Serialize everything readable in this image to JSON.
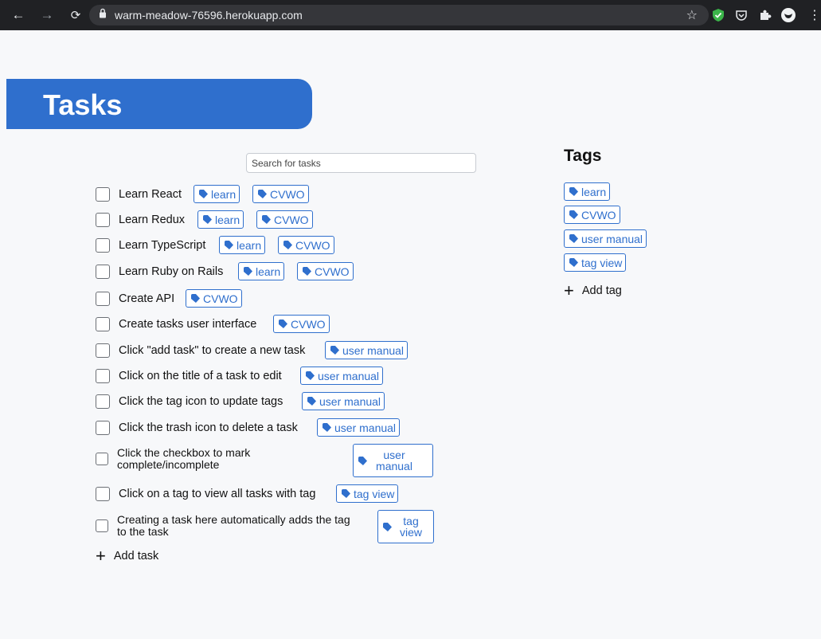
{
  "browser": {
    "url": "warm-meadow-76596.herokuapp.com",
    "back_icon": "arrow-left-icon",
    "forward_icon": "arrow-right-icon",
    "reload_icon": "reload-icon"
  },
  "header": {
    "title": "Tasks"
  },
  "search": {
    "placeholder": "Search for tasks",
    "value": ""
  },
  "tasks": [
    {
      "title": "Learn React",
      "tags": [
        "learn",
        "CVWO"
      ]
    },
    {
      "title": "Learn Redux",
      "tags": [
        "learn",
        "CVWO"
      ]
    },
    {
      "title": "Learn TypeScript",
      "tags": [
        "learn",
        "CVWO"
      ]
    },
    {
      "title": "Learn Ruby on Rails",
      "tags": [
        "learn",
        "CVWO"
      ]
    },
    {
      "title": "Create API",
      "tags": [
        "CVWO"
      ]
    },
    {
      "title": "Create tasks user interface",
      "tags": [
        "CVWO"
      ]
    },
    {
      "title": "Click \"add task\" to create a new task",
      "tags": [
        "user manual"
      ]
    },
    {
      "title": "Click on the title of a task to edit",
      "tags": [
        "user manual"
      ]
    },
    {
      "title": "Click the tag icon to update tags",
      "tags": [
        "user manual"
      ]
    },
    {
      "title": "Click the trash icon to delete a task",
      "tags": [
        "user manual"
      ]
    },
    {
      "title": "Click the checkbox to mark complete/incomplete",
      "tags": [
        "user manual"
      ]
    },
    {
      "title": "Click on a tag to view all tasks with tag",
      "tags": [
        "tag view"
      ]
    },
    {
      "title": "Creating a task here automatically adds the tag to the task",
      "tags": [
        "tag view"
      ]
    }
  ],
  "add_task_label": "Add task",
  "sidebar": {
    "heading": "Tags",
    "tags": [
      "learn",
      "CVWO",
      "user manual",
      "tag view"
    ],
    "add_tag_label": "Add tag"
  },
  "colors": {
    "accent": "#2f6fcd",
    "background": "#f7f8fa"
  }
}
